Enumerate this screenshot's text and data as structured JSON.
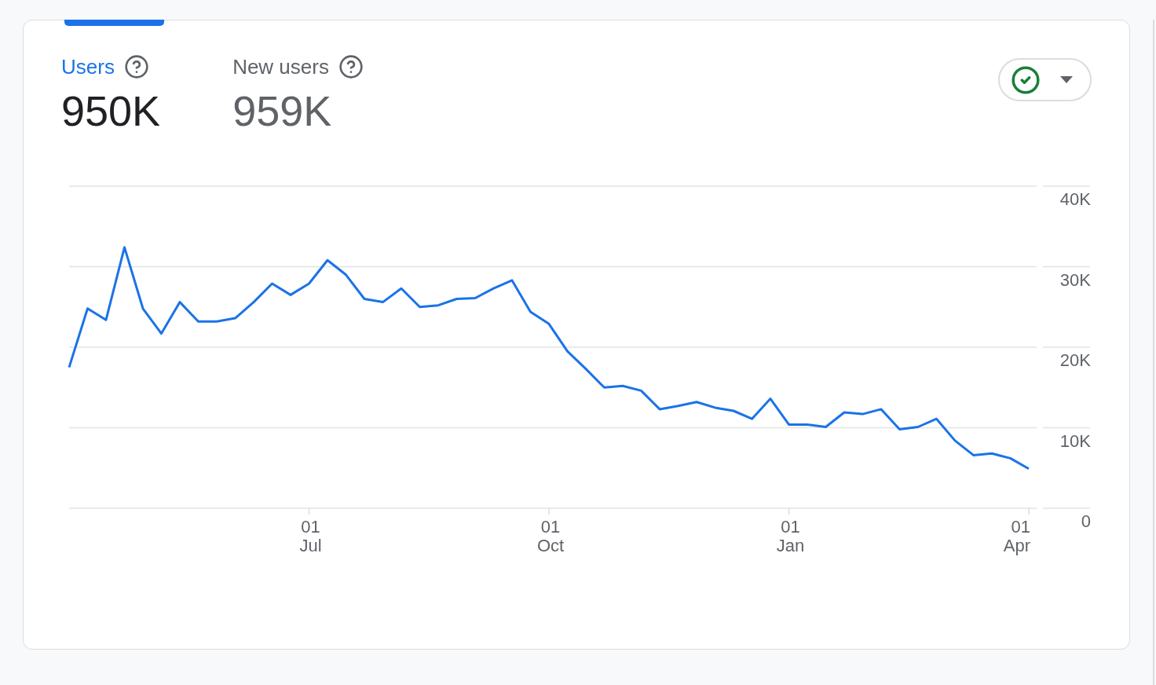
{
  "metric_tabs": [
    {
      "label": "Users",
      "value": "950K",
      "selected": true
    },
    {
      "label": "New users",
      "value": "959K",
      "selected": false
    }
  ],
  "chart": {
    "chart_data": {
      "type": "line",
      "categories": [
        null,
        null,
        null,
        null,
        null,
        null,
        null,
        null,
        null,
        null,
        null,
        null,
        null,
        "01\nJul",
        null,
        null,
        null,
        null,
        null,
        null,
        null,
        null,
        null,
        null,
        null,
        null,
        "01\nOct",
        null,
        null,
        null,
        null,
        null,
        null,
        null,
        null,
        null,
        null,
        null,
        null,
        "01\nJan",
        null,
        null,
        null,
        null,
        null,
        null,
        null,
        null,
        null,
        null,
        null,
        null,
        "01\nApr"
      ],
      "series": [
        {
          "color": "#1a73e8",
          "values": [
            17500,
            24800,
            23400,
            32400,
            24800,
            21700,
            25600,
            23200,
            23200,
            23600,
            25600,
            27900,
            26500,
            27900,
            30800,
            29000,
            26000,
            25600,
            27300,
            25000,
            25200,
            26000,
            26100,
            27300,
            28300,
            24400,
            22900,
            19500,
            17300,
            15000,
            15200,
            14600,
            12300,
            12700,
            13200,
            12500,
            12100,
            11100,
            13600,
            10400,
            10400,
            10100,
            11900,
            11700,
            12300,
            9800,
            10100,
            11100,
            8400,
            6600,
            6800,
            6200,
            4900
          ]
        }
      ],
      "ylim": [
        0,
        40000
      ],
      "grid": true,
      "yticks": [
        {
          "value": 0,
          "label": "0"
        },
        {
          "value": 10000,
          "label": "10K"
        },
        {
          "value": 20000,
          "label": "20K"
        },
        {
          "value": 30000,
          "label": "30K"
        },
        {
          "value": 40000,
          "label": "40K"
        }
      ]
    }
  }
}
